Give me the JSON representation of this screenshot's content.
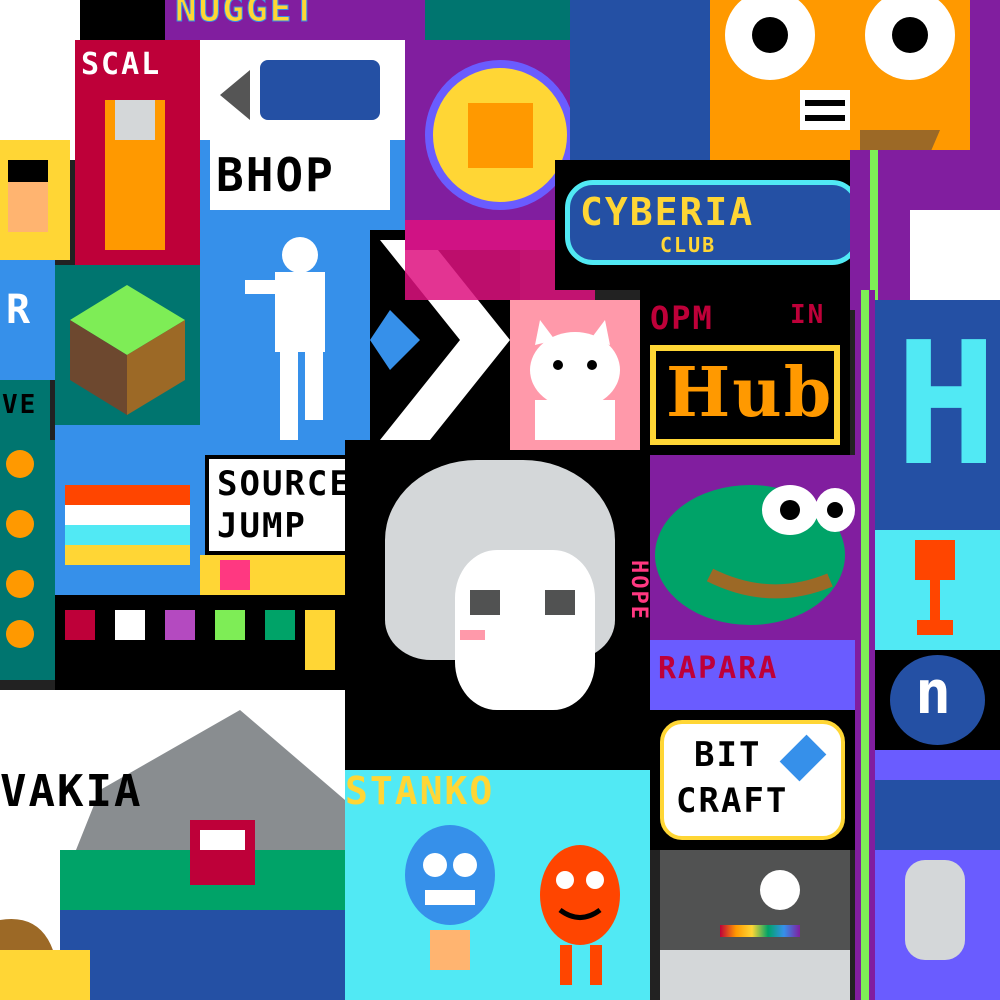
{
  "canvas": {
    "description_colors": {
      "black": "#000000",
      "white": "#ffffff",
      "sky_blue": "#3690ea",
      "cyan": "#51e9f4",
      "yellow": "#ffd635",
      "orange": "#ff9900",
      "red": "#be0039",
      "purple": "#811e9f",
      "green": "#00a368",
      "light_green": "#7eed56",
      "dark_blue": "#2450a4",
      "pink": "#ff99aa",
      "gray": "#898d90",
      "brown": "#9c6926"
    }
  },
  "texts": {
    "nugget": "NUGGET",
    "scal": "SCAL",
    "bhop": "BHOP",
    "cyberia": "CYBERIA",
    "club": "CLUB",
    "opm": "OPM",
    "opm_sub": "IN",
    "hub": "Hub",
    "source": "SOURCE",
    "jump": "JUMP",
    "stanko": "STANKO",
    "bit": "BIT",
    "craft": "CRAFT",
    "hope": "HOPE",
    "vakia": "VAKIA",
    "rapara": "RAPARA",
    "r_letter": "R",
    "ve": "VE",
    "h_letter": "H"
  },
  "icons": {
    "pepe": "pepe-frog-icon",
    "cat": "white-cat-icon",
    "gumball": "gumball-icon",
    "darwin": "darwin-icon",
    "owl": "owl-icon",
    "cable_car": "cable-car-icon",
    "minecraft_block": "grass-block-icon",
    "skull_coin": "skull-coin-icon",
    "trophy": "trophy-icon",
    "arrow": "chevron-right-icon",
    "runner": "runner-silhouette-icon",
    "diamond": "diamond-icon"
  }
}
